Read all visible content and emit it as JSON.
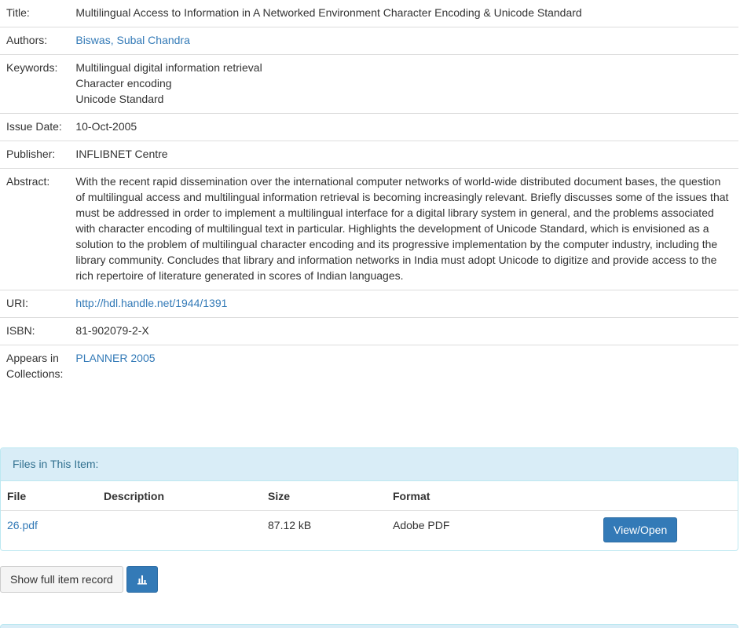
{
  "metadata": [
    {
      "label": "Title:",
      "values": [
        "Multilingual Access to Information in A Networked Environment Character Encoding & Unicode Standard"
      ],
      "link": false
    },
    {
      "label": "Authors:",
      "values": [
        "Biswas, Subal Chandra"
      ],
      "link": true
    },
    {
      "label": "Keywords:",
      "values": [
        "Multilingual digital information retrieval",
        "Character encoding",
        "Unicode Standard"
      ],
      "link": false
    },
    {
      "label": "Issue Date:",
      "values": [
        "10-Oct-2005"
      ],
      "link": false
    },
    {
      "label": "Publisher:",
      "values": [
        "INFLIBNET Centre"
      ],
      "link": false
    },
    {
      "label": "Abstract:",
      "values": [
        "With the recent rapid dissemination over the international computer networks of world-wide distributed document bases, the question of multilingual access and multilingual information retrieval is becoming increasingly relevant. Briefly discusses some of the issues that must be addressed in order to implement a multilingual interface for a digital library system in general, and the problems associated with character encoding of multilingual text in particular. Highlights the development of Unicode Standard, which is envisioned as a solution to the problem of multilingual character encoding and its progressive implementation by the computer industry, including the library community. Concludes that library and information networks in India must adopt Unicode to digitize and provide access to the rich repertoire of literature generated in scores of Indian languages."
      ],
      "link": false
    },
    {
      "label": "URI:",
      "values": [
        "http://hdl.handle.net/1944/1391"
      ],
      "link": true
    },
    {
      "label": "ISBN:",
      "values": [
        "81-902079-2-X"
      ],
      "link": false
    },
    {
      "label": "Appears in Collections:",
      "values": [
        "PLANNER 2005"
      ],
      "link": true
    }
  ],
  "files_panel": {
    "heading": "Files in This Item:",
    "columns": [
      "File",
      "Description",
      "Size",
      "Format"
    ],
    "rows": [
      {
        "file": "26.pdf",
        "description": "",
        "size": "87.12 kB",
        "format": "Adobe PDF",
        "action_label": "View/Open"
      }
    ]
  },
  "actions": {
    "full_record_label": "Show full item record",
    "stats_icon": "bar-chart-icon"
  },
  "colors": {
    "link": "#337ab7",
    "panel_heading_bg": "#d9edf7",
    "panel_heading_text": "#31708f",
    "primary_button": "#337ab7"
  }
}
